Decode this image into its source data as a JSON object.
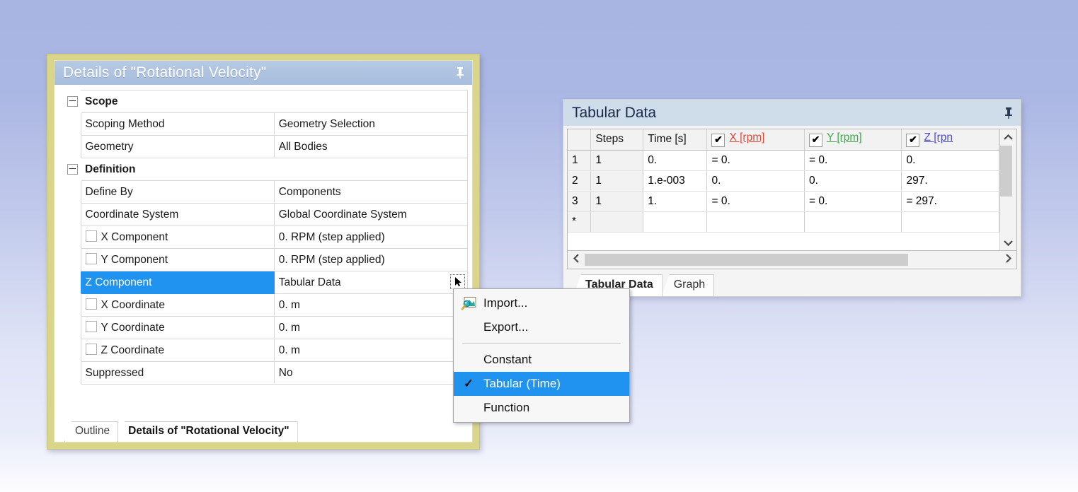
{
  "details_panel": {
    "title": "Details of \"Rotational Velocity\"",
    "pin_icon": "pin-icon",
    "rows": [
      {
        "kind": "group",
        "expander": "minus-expander",
        "label": "Scope",
        "value": ""
      },
      {
        "kind": "prop",
        "label": "Scoping Method",
        "value": "Geometry Selection"
      },
      {
        "kind": "prop",
        "label": "Geometry",
        "value": "All Bodies"
      },
      {
        "kind": "group",
        "expander": "minus-expander",
        "label": "Definition",
        "value": ""
      },
      {
        "kind": "prop",
        "label": "Define By",
        "value": "Components"
      },
      {
        "kind": "prop",
        "label": "Coordinate System",
        "value": "Global Coordinate System"
      },
      {
        "kind": "check",
        "label": "X Component",
        "value": "0. RPM  (step applied)"
      },
      {
        "kind": "check",
        "label": "Y Component",
        "value": "0. RPM  (step applied)"
      },
      {
        "kind": "selected",
        "label": "Z Component",
        "value": "Tabular Data"
      },
      {
        "kind": "check",
        "label": "X Coordinate",
        "value": "0. m"
      },
      {
        "kind": "check",
        "label": "Y Coordinate",
        "value": "0. m"
      },
      {
        "kind": "check",
        "label": "Z Coordinate",
        "value": "0. m"
      },
      {
        "kind": "prop",
        "label": "Suppressed",
        "value": "No"
      }
    ],
    "tabs": [
      {
        "label": "Outline",
        "active": false
      },
      {
        "label": "Details of \"Rotational Velocity\"",
        "active": true
      }
    ]
  },
  "context_menu": {
    "items": [
      {
        "label": "Import...",
        "icon": "import-icon",
        "checked": false,
        "highlight": false
      },
      {
        "label": "Export...",
        "icon": "",
        "checked": false,
        "highlight": false
      },
      {
        "separator": true
      },
      {
        "label": "Constant",
        "icon": "",
        "checked": false,
        "highlight": false
      },
      {
        "label": "Tabular (Time)",
        "icon": "",
        "checked": true,
        "highlight": true
      },
      {
        "label": "Function",
        "icon": "",
        "checked": false,
        "highlight": false
      }
    ],
    "check_glyph": "✓"
  },
  "tabular_panel": {
    "title": "Tabular Data",
    "pin_icon": "pin-icon",
    "columns": [
      {
        "id": "rownum",
        "label": "",
        "checkbox": false,
        "color_class": ""
      },
      {
        "id": "steps",
        "label": "Steps",
        "checkbox": false,
        "color_class": ""
      },
      {
        "id": "time",
        "label": "Time [s]",
        "checkbox": false,
        "color_class": ""
      },
      {
        "id": "x",
        "label": "X [rpm]",
        "checkbox": true,
        "color_class": "lbl-x"
      },
      {
        "id": "y",
        "label": "Y [rpm]",
        "checkbox": true,
        "color_class": "lbl-y"
      },
      {
        "id": "z",
        "label": "Z [rpn",
        "checkbox": true,
        "color_class": "lbl-z"
      }
    ],
    "rows": [
      {
        "rownum": "1",
        "steps": "1",
        "time": "0.",
        "x": "= 0.",
        "y": "= 0.",
        "z": "0."
      },
      {
        "rownum": "2",
        "steps": "1",
        "time": "1.e-003",
        "x": "0.",
        "y": "0.",
        "z": "297."
      },
      {
        "rownum": "3",
        "steps": "1",
        "time": "1.",
        "x": "= 0.",
        "y": "= 0.",
        "z": "= 297."
      },
      {
        "rownum": "*",
        "steps": "",
        "time": "",
        "x": "",
        "y": "",
        "z": ""
      }
    ],
    "check_glyph": "✔",
    "scroll_up_icon": "chevron-up-icon",
    "scroll_down_icon": "chevron-down-icon",
    "scroll_left_icon": "chevron-left-icon",
    "scroll_right_icon": "chevron-right-icon",
    "tabs": [
      {
        "label": "Tabular Data",
        "active": true
      },
      {
        "label": "Graph",
        "active": false
      }
    ]
  },
  "colors": {
    "selection_blue": "#1f93ef",
    "details_frame_yellow": "#d9d58a",
    "details_title_blue": "#aec3e0",
    "tabular_title_blue": "#cfdcea",
    "x_label_red": "#e04a3a",
    "y_label_green": "#3faa4f",
    "z_label_blue": "#4a4ad6",
    "desktop_background": "#a8b4e2"
  }
}
